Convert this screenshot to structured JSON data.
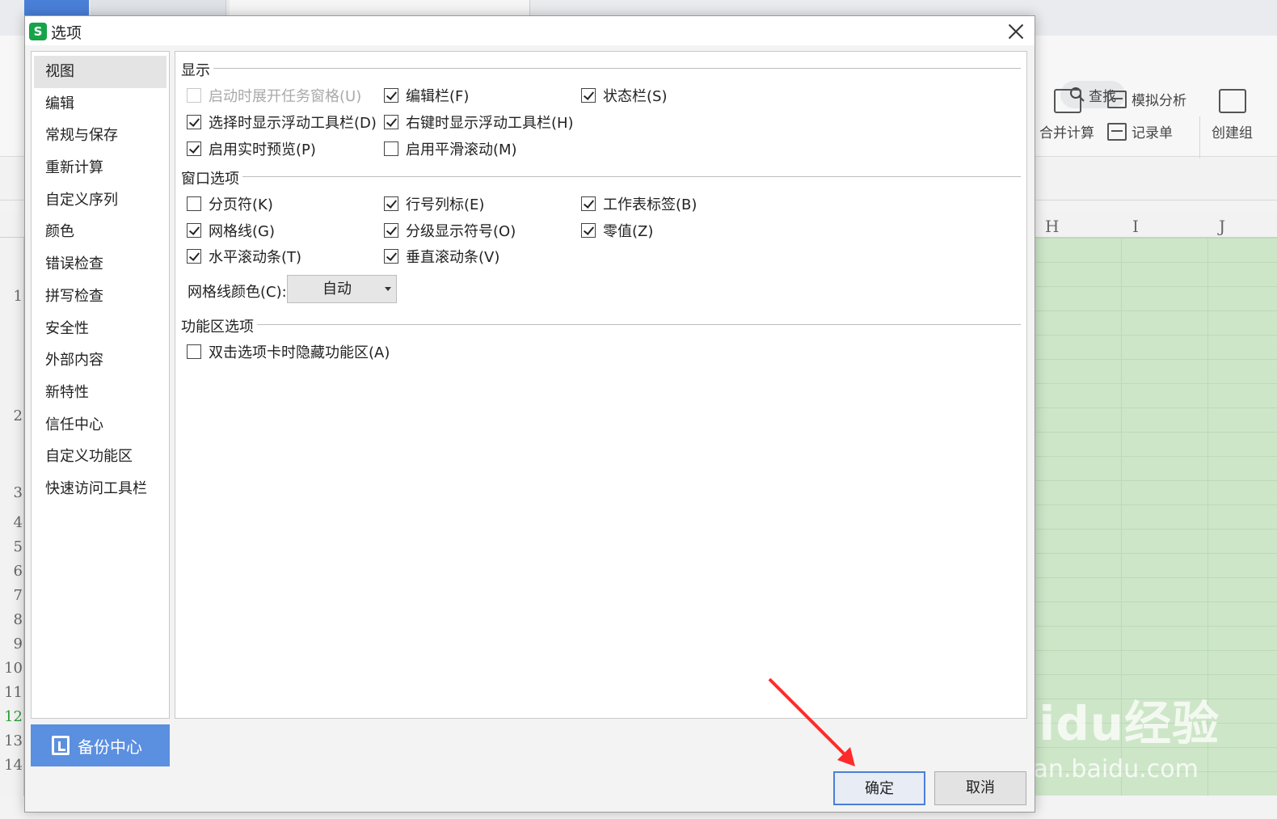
{
  "dialog": {
    "title": "选项",
    "app_icon_letter": "S",
    "nav": [
      "视图",
      "编辑",
      "常规与保存",
      "重新计算",
      "自定义序列",
      "颜色",
      "错误检查",
      "拼写检查",
      "安全性",
      "外部内容",
      "新特性",
      "信任中心",
      "自定义功能区",
      "快速访问工具栏"
    ],
    "nav_selected_index": 0,
    "backup_label": "备份中心",
    "sections": {
      "display": {
        "title": "显示",
        "options": [
          {
            "label": "启动时展开任务窗格(U)",
            "checked": false,
            "disabled": true
          },
          {
            "label": "编辑栏(F)",
            "checked": true
          },
          {
            "label": "状态栏(S)",
            "checked": true
          },
          {
            "label": "选择时显示浮动工具栏(D)",
            "checked": true
          },
          {
            "label": "右键时显示浮动工具栏(H)",
            "checked": true
          },
          {
            "label": "启用实时预览(P)",
            "checked": true
          },
          {
            "label": "启用平滑滚动(M)",
            "checked": false
          }
        ]
      },
      "window": {
        "title": "窗口选项",
        "options": [
          {
            "label": "分页符(K)",
            "checked": false
          },
          {
            "label": "行号列标(E)",
            "checked": true
          },
          {
            "label": "工作表标签(B)",
            "checked": true
          },
          {
            "label": "网格线(G)",
            "checked": true
          },
          {
            "label": "分级显示符号(O)",
            "checked": true
          },
          {
            "label": "零值(Z)",
            "checked": true
          },
          {
            "label": "水平滚动条(T)",
            "checked": true
          },
          {
            "label": "垂直滚动条(V)",
            "checked": true
          }
        ],
        "gridline_color_label": "网格线颜色(C):",
        "gridline_color_value": "自动"
      },
      "ribbon": {
        "title": "功能区选项",
        "options": [
          {
            "label": "双击选项卡时隐藏功能区(A)",
            "checked": false
          }
        ]
      }
    },
    "ok_label": "确定",
    "cancel_label": "取消"
  },
  "background": {
    "search_label": "查找",
    "ribbon": {
      "consolidate": "合并计算",
      "what_if": "模拟分析",
      "record_form": "记录单",
      "create_group": "创建组"
    },
    "columns": [
      "H",
      "I",
      "J"
    ],
    "row_numbers": [
      "1",
      "2",
      "3",
      "4",
      "5",
      "6",
      "7",
      "8",
      "9",
      "10",
      "11",
      "12",
      "13",
      "14"
    ]
  },
  "watermark": {
    "brand": "Baidu经验",
    "url": "jingyan.baidu.com"
  },
  "colors": {
    "accent": "#4a7fd8",
    "backup_button": "#5b8fe0",
    "sheet_fill": "#cde6c8",
    "app_icon": "#16a34a",
    "annotation_arrow": "#ff2a2a"
  }
}
